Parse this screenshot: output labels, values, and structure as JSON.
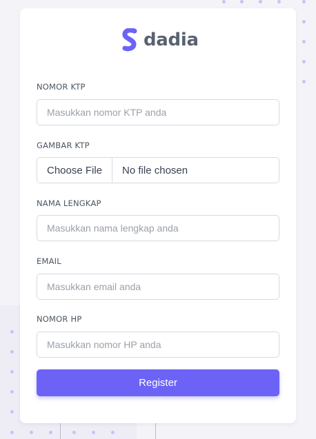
{
  "brand": {
    "name": "dadia",
    "logo_icon": "dadia-s-logo-icon",
    "logo_color": "#6c63f6"
  },
  "form": {
    "fields": [
      {
        "label": "NOMOR KTP",
        "placeholder": "Masukkan nomor KTP anda",
        "type": "text"
      },
      {
        "label": "GAMBAR KTP",
        "type": "file",
        "button_label": "Choose File",
        "status": "No file chosen"
      },
      {
        "label": "NAMA LENGKAP",
        "placeholder": "Masukkan nama lengkap anda",
        "type": "text"
      },
      {
        "label": "EMAIL",
        "placeholder": "Masukkan email anda",
        "type": "text"
      },
      {
        "label": "NOMOR HP",
        "placeholder": "Masukkan nomor HP anda",
        "type": "text"
      }
    ],
    "submit_label": "Register"
  },
  "colors": {
    "accent": "#6c63f6",
    "background": "#f4f4f8",
    "card": "#ffffff",
    "dots": "#c7c3f5"
  }
}
